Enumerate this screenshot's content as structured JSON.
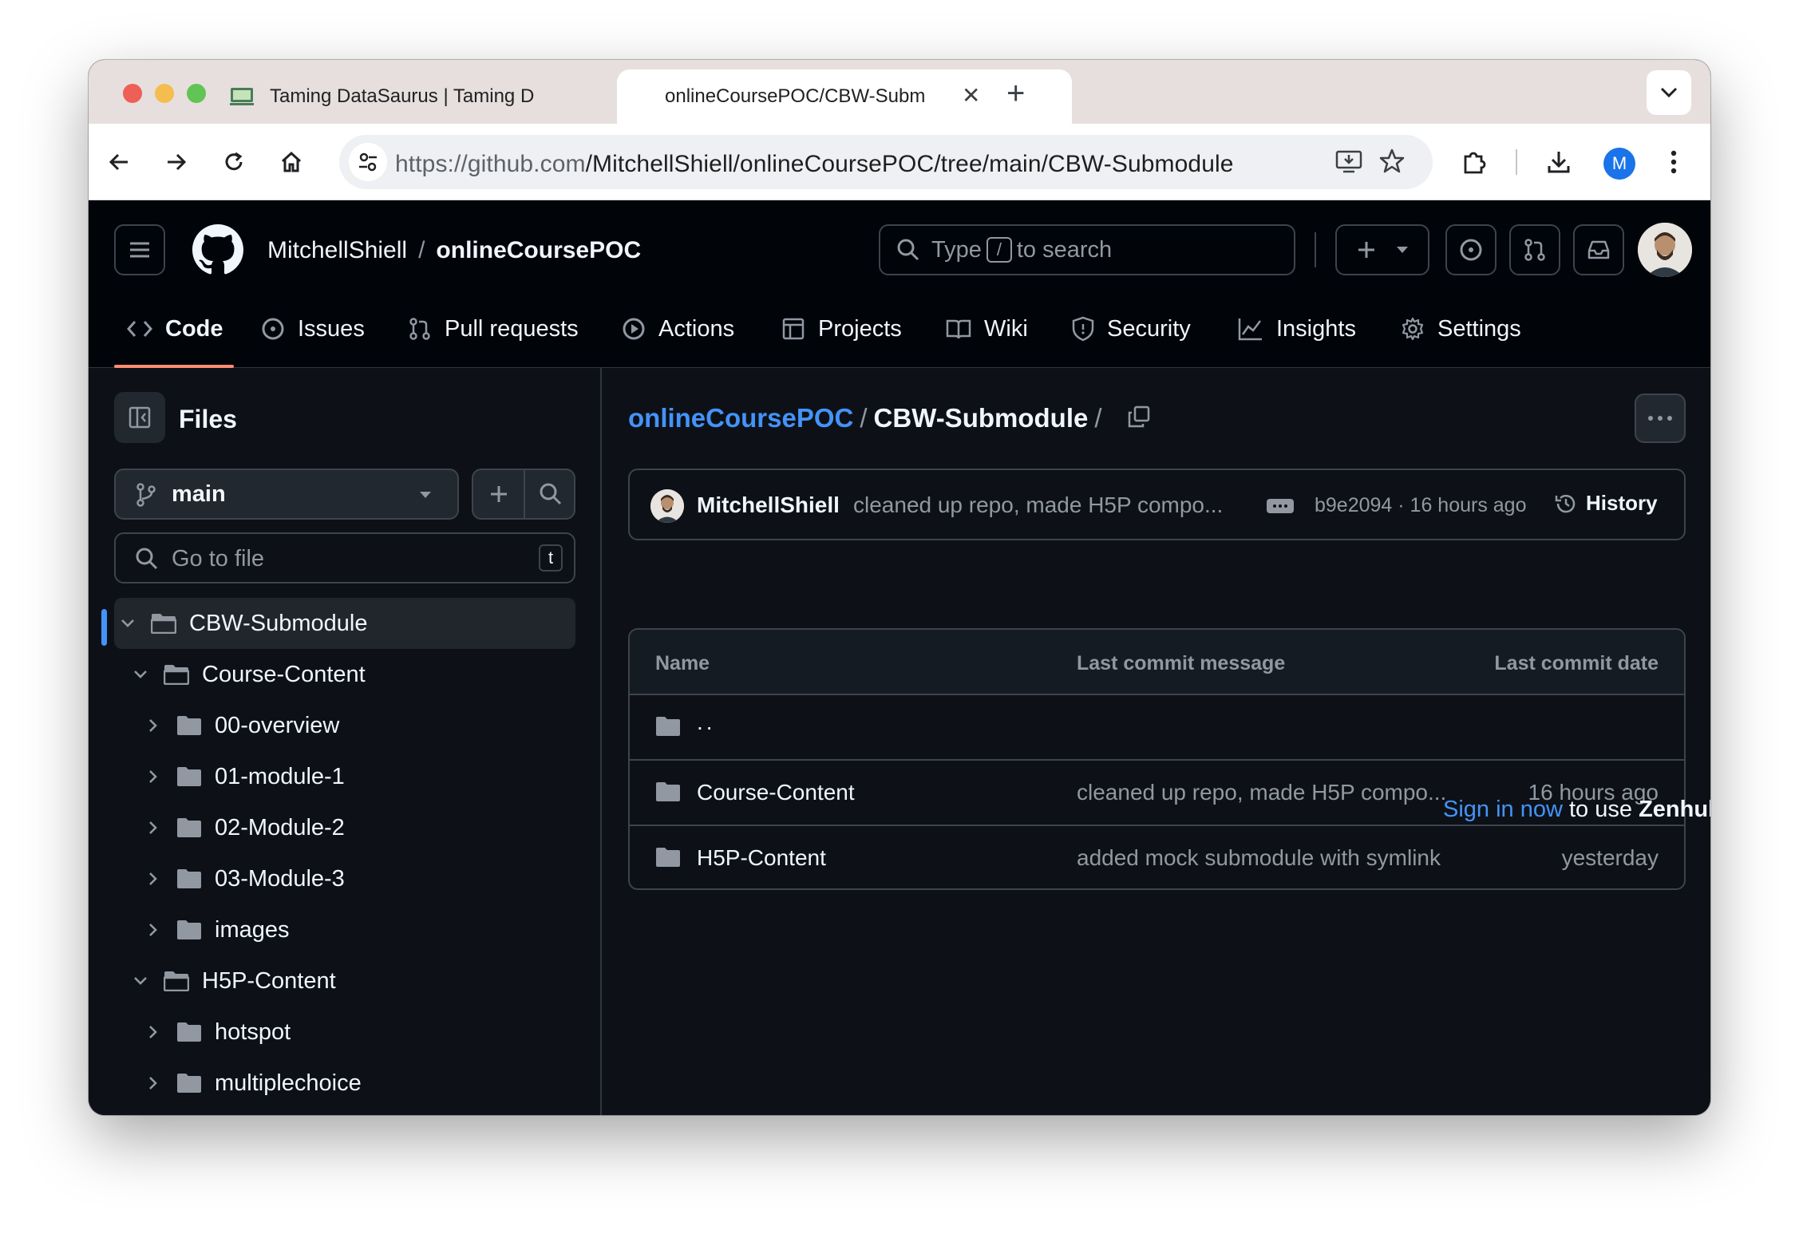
{
  "browser": {
    "tabs": [
      {
        "title": "Taming DataSaurus | Taming D",
        "active": false
      },
      {
        "title": "onlineCoursePOC/CBW-Subm",
        "active": true
      }
    ],
    "url_host": "https://github.com",
    "url_path": "/MitchellShiell/onlineCoursePOC/tree/main/CBW-Submodule",
    "profile_initial": "M"
  },
  "header": {
    "owner": "MitchellShiell",
    "separator": "/",
    "repo": "onlineCoursePOC",
    "search_prefix": "Type",
    "search_key": "/",
    "search_suffix": "to search"
  },
  "nav": {
    "code": "Code",
    "issues": "Issues",
    "pull_requests": "Pull requests",
    "actions": "Actions",
    "projects": "Projects",
    "wiki": "Wiki",
    "security": "Security",
    "insights": "Insights",
    "settings": "Settings"
  },
  "sidebar": {
    "title": "Files",
    "branch": "main",
    "goto_placeholder": "Go to file",
    "goto_key": "t",
    "tree": [
      {
        "label": "CBW-Submodule",
        "level": 0,
        "expanded": true,
        "selected": true
      },
      {
        "label": "Course-Content",
        "level": 1,
        "expanded": true
      },
      {
        "label": "00-overview",
        "level": 2,
        "expanded": false
      },
      {
        "label": "01-module-1",
        "level": 2,
        "expanded": false
      },
      {
        "label": "02-Module-2",
        "level": 2,
        "expanded": false
      },
      {
        "label": "03-Module-3",
        "level": 2,
        "expanded": false
      },
      {
        "label": "images",
        "level": 2,
        "expanded": false
      },
      {
        "label": "H5P-Content",
        "level": 1,
        "expanded": true
      },
      {
        "label": "hotspot",
        "level": 2,
        "expanded": false
      },
      {
        "label": "multiplechoice",
        "level": 2,
        "expanded": false
      }
    ]
  },
  "main": {
    "breadcrumb_repo": "onlineCoursePOC",
    "breadcrumb_sep": "/",
    "breadcrumb_current": "CBW-Submodule",
    "commit": {
      "author": "MitchellShiell",
      "message": "cleaned up repo, made H5P compo...",
      "meta": "b9e2094 · 16 hours ago",
      "history": "History"
    },
    "table": {
      "headers": [
        "Name",
        "Last commit message",
        "Last commit date"
      ],
      "parent": "..",
      "rows": [
        {
          "name": "Course-Content",
          "message": "cleaned up repo, made H5P compo...",
          "date": "16 hours ago"
        },
        {
          "name": "H5P-Content",
          "message": "added mock submodule with symlink",
          "date": "yesterday"
        }
      ]
    },
    "zenhub": {
      "link": "Sign in now",
      "middle": "to use",
      "brand": "Zenhub"
    }
  },
  "colors": {
    "bg": "#0d1117",
    "header_bg": "#010409",
    "accent_link": "#4493f8",
    "nav_underline": "#fd8c73",
    "folder": "#9198a1"
  }
}
